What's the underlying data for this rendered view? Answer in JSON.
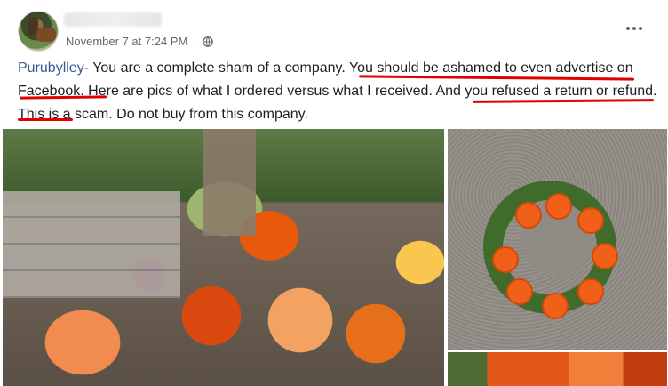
{
  "post": {
    "timestamp": "November 7 at 7:24 PM",
    "separator": "·",
    "privacy_icon": "globe-icon",
    "more_icon": "more-options-icon",
    "text": {
      "mention": "Purubylley-",
      "part1": " You are a complete sham of a company. ",
      "part2": "You should be ashamed to even advertise on Facebook",
      "part3": ". Here are pics of what I ordered versus what I received. ",
      "part4": "And you refused a return or refund",
      "part5": ". This is a scam. Do not buy from this company."
    }
  },
  "colors": {
    "mention": "#385898",
    "underline": "#e00000",
    "meta_text": "#65676b",
    "body_text": "#1c1e21"
  }
}
